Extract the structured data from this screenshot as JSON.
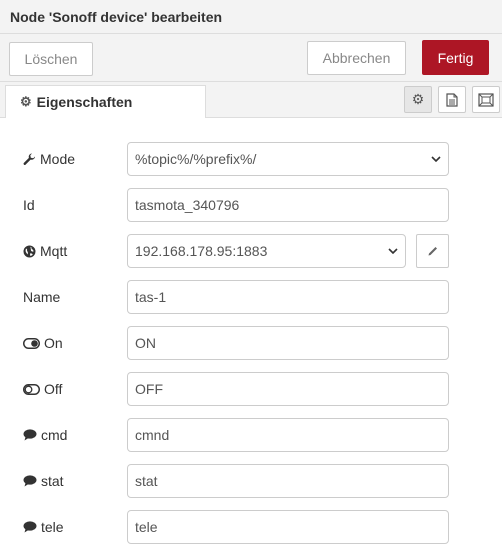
{
  "header": {
    "title": "Node 'Sonoff device' bearbeiten"
  },
  "toolbar": {
    "delete_label": "Löschen",
    "cancel_label": "Abbrechen",
    "done_label": "Fertig"
  },
  "tabs": {
    "properties_label": "Eigenschaften"
  },
  "form": {
    "mode": {
      "label": "Mode",
      "value": "%topic%/%prefix%/"
    },
    "id": {
      "label": "Id",
      "value": "tasmota_340796"
    },
    "mqtt": {
      "label": "Mqtt",
      "value": "192.168.178.95:1883"
    },
    "name": {
      "label": "Name",
      "value": "tas-1"
    },
    "on": {
      "label": "On",
      "value": "ON"
    },
    "off": {
      "label": "Off",
      "value": "OFF"
    },
    "cmd": {
      "label": "cmd",
      "value": "cmnd"
    },
    "stat": {
      "label": "stat",
      "value": "stat"
    },
    "tele": {
      "label": "tele",
      "value": "tele"
    }
  },
  "colors": {
    "accent": "#ad1625",
    "panel": "#f3f3f3",
    "border": "#cccccc"
  }
}
